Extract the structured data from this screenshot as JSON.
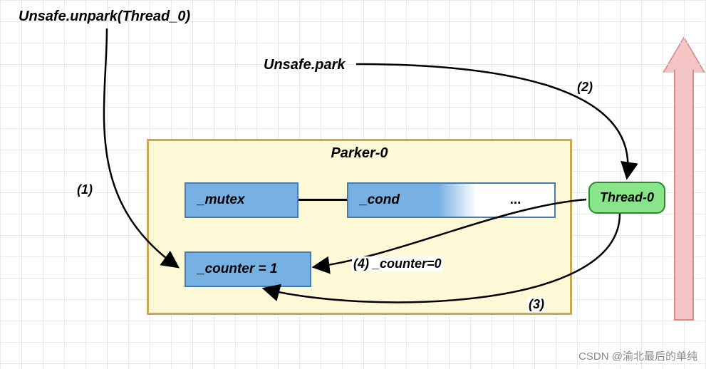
{
  "labels": {
    "unpark": "Unsafe.unpark(Thread_0)",
    "park": "Unsafe.park",
    "step1": "(1)",
    "step2": "(2)",
    "step3": "(3)",
    "step4": "(4) _counter=0"
  },
  "parker": {
    "title": "Parker-0",
    "mutex": "_mutex",
    "cond": "_cond",
    "cond_dots": "...",
    "counter": "_counter = 1"
  },
  "thread": {
    "label": "Thread-0"
  },
  "watermark": "CSDN @渝北最后的单纯"
}
